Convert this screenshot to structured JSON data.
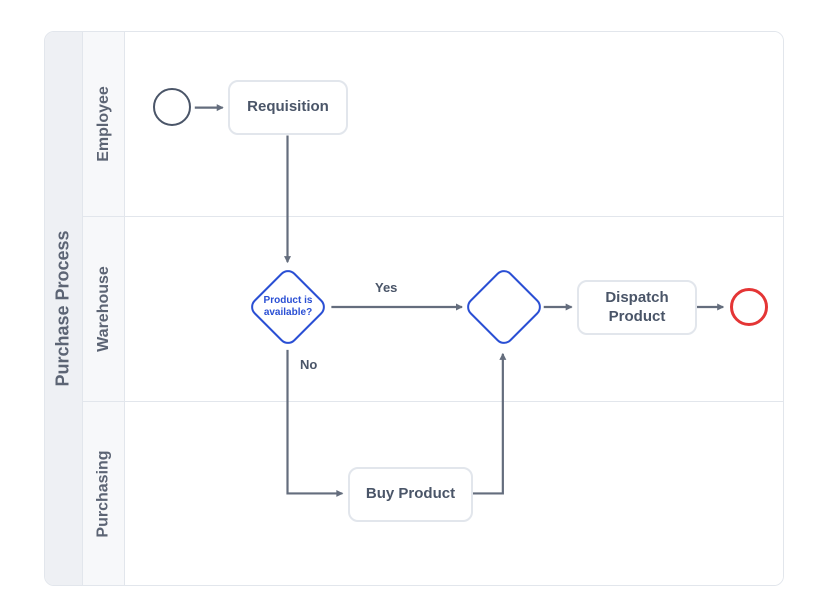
{
  "pool": {
    "title": "Purchase Process"
  },
  "lanes": [
    {
      "title": "Employee"
    },
    {
      "title": "Warehouse"
    },
    {
      "title": "Purchasing"
    }
  ],
  "nodes": {
    "requisition": {
      "label": "Requisition"
    },
    "productAvailable": {
      "label": "Product is available?"
    },
    "dispatchProduct": {
      "label": "Dispatch Product"
    },
    "buyProduct": {
      "label": "Buy Product"
    }
  },
  "edges": {
    "yes": {
      "label": "Yes"
    },
    "no": {
      "label": "No"
    }
  },
  "colors": {
    "text": "#4a5568",
    "border": "#e2e6ec",
    "gateway": "#2a4fd4",
    "end": "#e43535",
    "poolBg": "#eef0f4",
    "laneBg": "#f7f8fa"
  }
}
